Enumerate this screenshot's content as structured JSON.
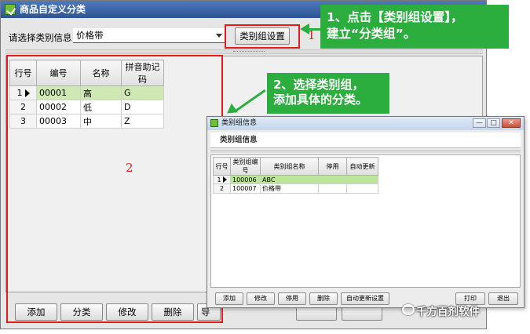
{
  "main_window": {
    "title": "商品自定义分类",
    "select_label": "请选择类别信息",
    "select_value": "价格带",
    "category_group_button": "类别组设置",
    "grid": {
      "columns": [
        "行号",
        "编号",
        "名称",
        "拼音助记码"
      ],
      "rows": [
        {
          "num": "1",
          "code": "00001",
          "name": "高",
          "pinyin": "G"
        },
        {
          "num": "2",
          "code": "00002",
          "name": "低",
          "pinyin": "D"
        },
        {
          "num": "3",
          "code": "00003",
          "name": "中",
          "pinyin": "Z"
        }
      ]
    },
    "buttons": [
      "添加",
      "分类",
      "修改",
      "删除",
      "导"
    ]
  },
  "annotations": {
    "label_1": "1",
    "label_2": "2",
    "callout_1_line1": "1、点击【类别组设置】，",
    "callout_1_line2": "建立“分类组”。",
    "callout_2_line1": "2、选择类别组，",
    "callout_2_line2": "添加具体的分类。",
    "colors": {
      "red": "#e21c1c",
      "green": "#2cae3f"
    }
  },
  "dialog": {
    "title": "类别组信息",
    "header": "类别组信息",
    "window_controls": {
      "minimize": "—",
      "maximize": "□",
      "close": "✕"
    },
    "grid": {
      "columns": [
        "行号",
        "类别组编号",
        "类别组名称",
        "停用",
        "自动更新"
      ],
      "rows": [
        {
          "num": "1",
          "code": "100006",
          "name": "ABC",
          "disabled": "",
          "auto": ""
        },
        {
          "num": "2",
          "code": "100007",
          "name": "价格带",
          "disabled": "",
          "auto": ""
        }
      ]
    },
    "buttons": {
      "add": "添加",
      "edit": "修改",
      "disable": "停用",
      "delete": "删除",
      "auto_update": "自动更新设置",
      "print": "打印",
      "exit": "退出"
    }
  },
  "watermark": "千方百剂软件"
}
